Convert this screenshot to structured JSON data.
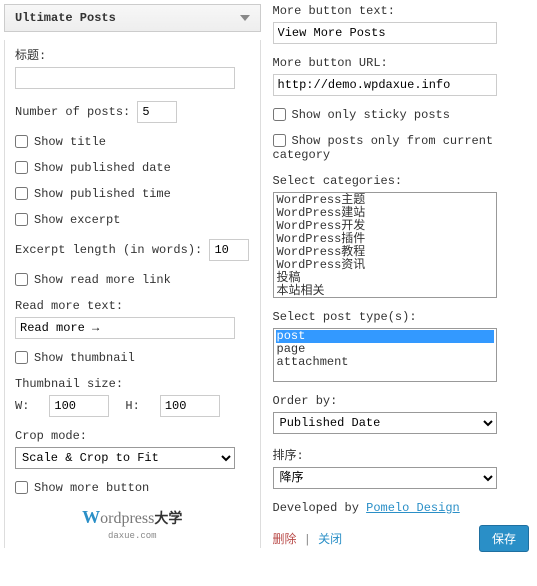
{
  "widget_title": "Ultimate Posts",
  "left": {
    "title_label": "标题:",
    "title_value": "",
    "num_posts_label": "Number of posts:",
    "num_posts_value": "5",
    "show_title": "Show title",
    "show_pub_date": "Show published date",
    "show_pub_time": "Show published time",
    "show_excerpt": "Show excerpt",
    "excerpt_len_label": "Excerpt length (in words):",
    "excerpt_len_value": "10",
    "show_read_more": "Show read more link",
    "read_more_label": "Read more text:",
    "read_more_value": "Read more →",
    "show_thumb": "Show thumbnail",
    "thumb_size_label": "Thumbnail size:",
    "thumb_w_label": "W:",
    "thumb_w_value": "100",
    "thumb_h_label": "H:",
    "thumb_h_value": "100",
    "crop_label": "Crop mode:",
    "crop_value": "Scale & Crop to Fit",
    "show_more_btn": "Show more button"
  },
  "right": {
    "more_btn_label": "More button text:",
    "more_btn_value": "View More Posts",
    "more_url_label": "More button URL:",
    "more_url_value": "http://demo.wpdaxue.info",
    "sticky_only": "Show only sticky posts",
    "current_cat": "Show posts only from current category",
    "sel_cats_label": "Select categories:",
    "cats": [
      "WordPress主题",
      "WordPress建站",
      "WordPress开发",
      "WordPress插件",
      "WordPress教程",
      "WordPress资讯",
      "投稿",
      "本站相关"
    ],
    "sel_types_label": "Select post type(s):",
    "types": [
      "post",
      "page",
      "attachment"
    ],
    "order_by_label": "Order by:",
    "order_by_value": "Published Date",
    "sort_label": "排序:",
    "sort_value": "降序",
    "dev_prefix": "Developed by ",
    "dev_link": "Pomelo Design",
    "delete": "删除",
    "sep": " | ",
    "close": "关闭",
    "save": "保存"
  },
  "logo": {
    "w": "W",
    "rest": "ordpress",
    "cn": "大学",
    "sub": "daxue.com"
  }
}
